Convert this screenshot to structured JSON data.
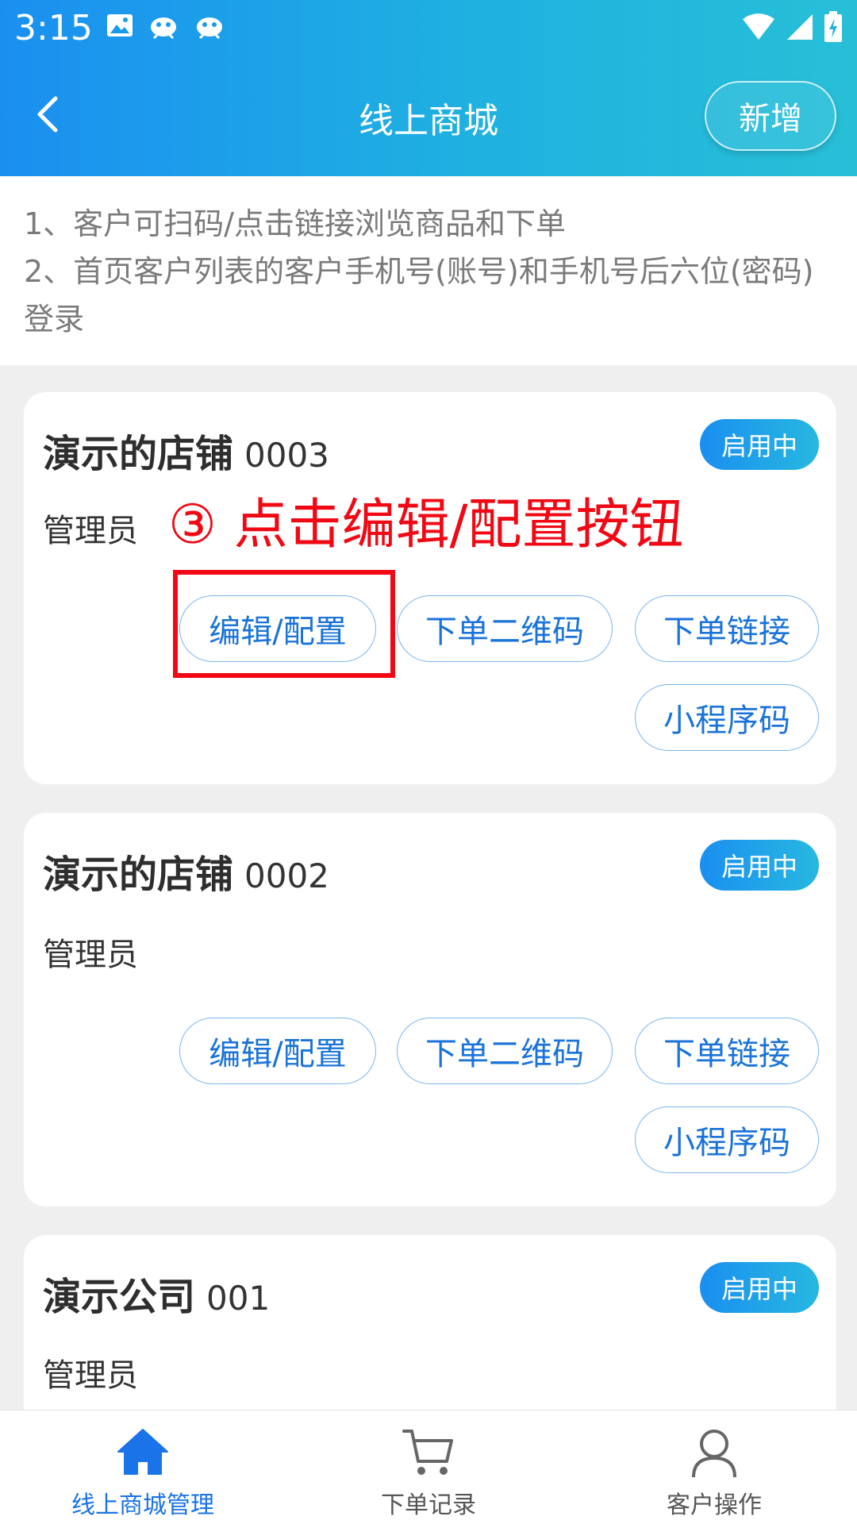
{
  "status_bar": {
    "time": "3:15"
  },
  "nav": {
    "title": "线上商城",
    "add_label": "新增"
  },
  "notice": {
    "line1": "1、客户可扫码/点击链接浏览商品和下单",
    "line2": "2、首页客户列表的客户手机号(账号)和手机号后六位(密码)登录"
  },
  "annotation": {
    "text": "③ 点击编辑/配置按钮"
  },
  "actions": {
    "edit": "编辑/配置",
    "qrcode": "下单二维码",
    "link": "下单链接",
    "miniprogram": "小程序码"
  },
  "shops": [
    {
      "name": "演示的店铺",
      "code": "0003",
      "status": "启用中",
      "role": "管理员"
    },
    {
      "name": "演示的店铺",
      "code": "0002",
      "status": "启用中",
      "role": "管理员"
    },
    {
      "name": "演示公司",
      "code": "001",
      "status": "启用中",
      "role": "管理员"
    }
  ],
  "tabbar": {
    "tabs": [
      {
        "label": "线上商城管理",
        "icon": "home-icon",
        "active": true
      },
      {
        "label": "下单记录",
        "icon": "cart-icon",
        "active": false
      },
      {
        "label": "客户操作",
        "icon": "user-icon",
        "active": false
      }
    ]
  },
  "colors": {
    "primary": "#1a8ff0",
    "accent_red": "#f00914",
    "link_blue": "#1a73d8"
  }
}
